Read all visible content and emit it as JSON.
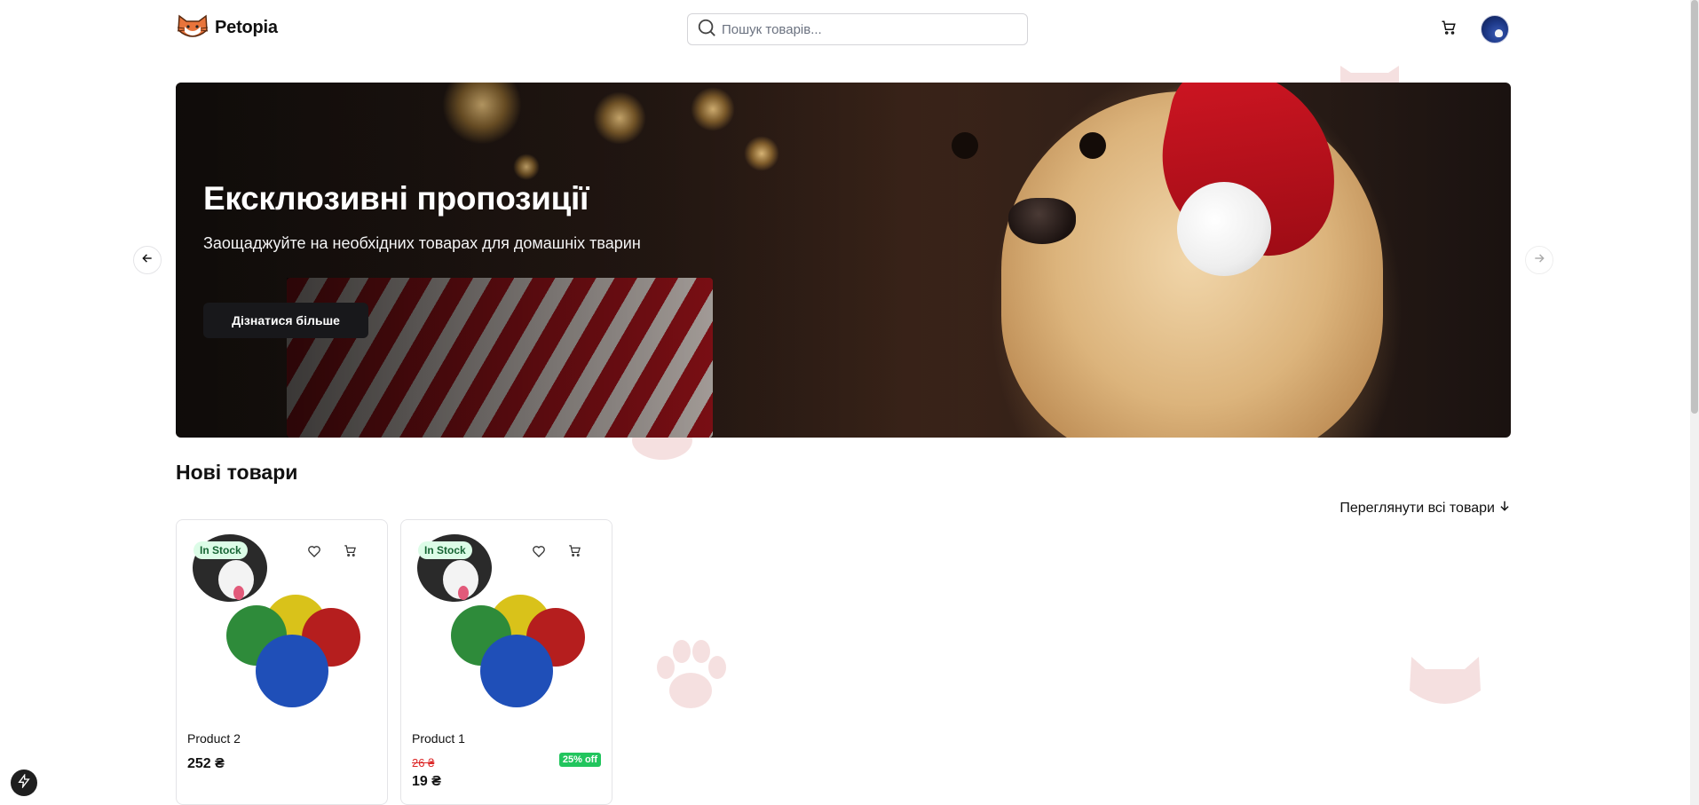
{
  "header": {
    "brand": "Petopia",
    "search_placeholder": "Пошук товарів...",
    "icons": {
      "logo": "cat-icon",
      "search": "search-icon",
      "cart": "cart-icon",
      "avatar": "avatar"
    }
  },
  "hero": {
    "title": "Ексклюзивні пропозиції",
    "subtitle": "Заощаджуйте на необхідних товарах для домашніх тварин",
    "button_label": "Дізнатися більше",
    "prev_icon": "arrow-left-icon",
    "next_icon": "arrow-right-icon"
  },
  "new_products": {
    "title": "Нові товари",
    "view_all_label": "Переглянути всі товари",
    "view_all_icon": "arrow-down-icon",
    "products": [
      {
        "name": "Product 2",
        "badge": "In Stock",
        "price": "252 ₴"
      },
      {
        "name": "Product 1",
        "badge": "In Stock",
        "old_price": "26 ₴",
        "price": "19 ₴",
        "discount": "25% off"
      }
    ]
  },
  "colors": {
    "primary": "#18181b",
    "badge_bg": "#dcfce7",
    "badge_text": "#166534",
    "discount": "#22c55e",
    "old_price": "#dc2626"
  }
}
